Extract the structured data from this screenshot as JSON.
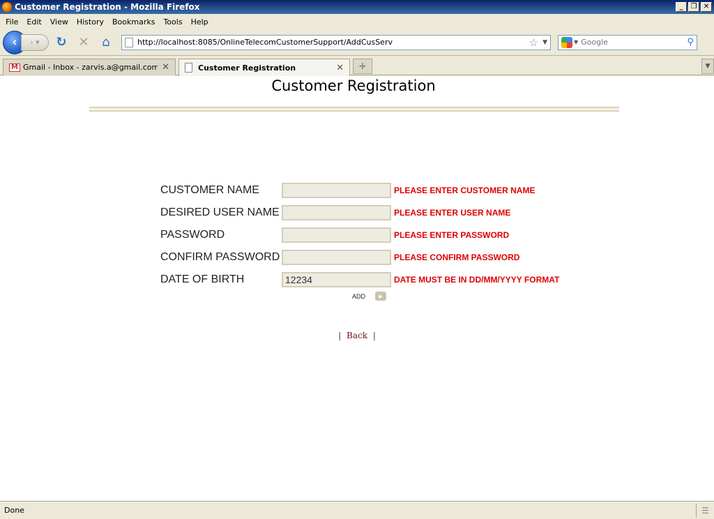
{
  "window": {
    "title": "Customer Registration - Mozilla Firefox",
    "minimize": "_",
    "restore": "❐",
    "close": "✕"
  },
  "menu": [
    "File",
    "Edit",
    "View",
    "History",
    "Bookmarks",
    "Tools",
    "Help"
  ],
  "nav": {
    "url": "http://localhost:8085/OnlineTelecomCustomerSupport/AddCusServ",
    "search_placeholder": "Google"
  },
  "tabs": [
    {
      "label": "Gmail - Inbox - zarvis.a@gmail.com",
      "active": false
    },
    {
      "label": "Customer Registration",
      "active": true
    }
  ],
  "page": {
    "title": "Customer Registration",
    "fields": [
      {
        "label": "CUSTOMER NAME",
        "value": "",
        "error": "PLEASE ENTER CUSTOMER NAME"
      },
      {
        "label": "DESIRED USER NAME",
        "value": "",
        "error": "PLEASE ENTER USER NAME"
      },
      {
        "label": "PASSWORD",
        "value": "",
        "error": "PLEASE ENTER PASSWORD"
      },
      {
        "label": "CONFIRM PASSWORD",
        "value": "",
        "error": "PLEASE CONFIRM PASSWORD"
      },
      {
        "label": "DATE OF BIRTH",
        "value": "12234",
        "error": "DATE MUST BE IN DD/MM/YYYY FORMAT"
      }
    ],
    "add_label": "ADD",
    "back_prefix": "|",
    "back_link": "Back",
    "back_suffix": "|"
  },
  "status": {
    "text": "Done"
  },
  "colors": {
    "error": "#e00000",
    "input_bg": "#eeebe1",
    "link": "#6b1010"
  }
}
